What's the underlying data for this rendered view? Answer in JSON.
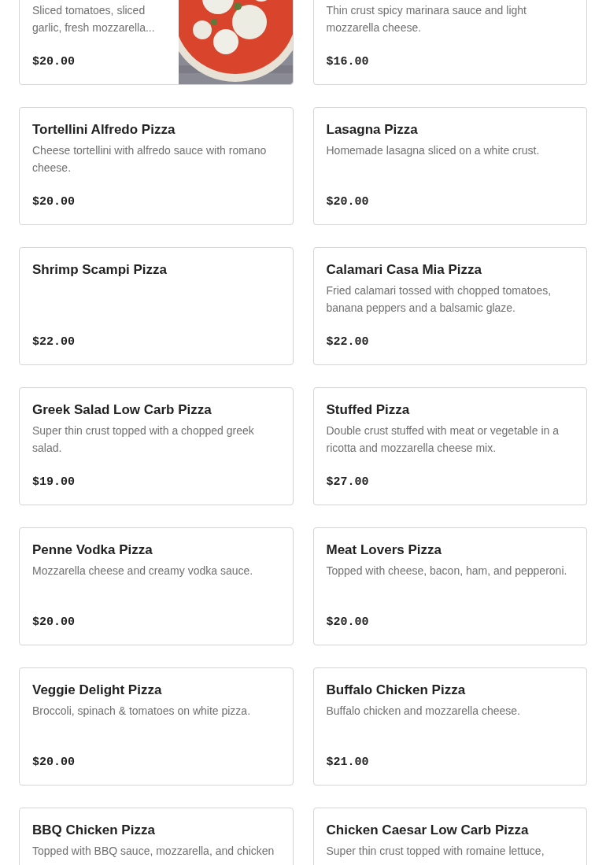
{
  "menu_items": [
    {
      "kind": "with-photo",
      "description": "Sliced tomatoes, sliced garlic, fresh mozzarella...",
      "price": "$20.00"
    },
    {
      "kind": "plain",
      "description": "Thin crust spicy marinara sauce and light mozzarella cheese.",
      "price": "$16.00"
    },
    {
      "kind": "plain",
      "name": "Tortellini Alfredo Pizza",
      "description": "Cheese tortellini with alfredo sauce with romano cheese.",
      "price": "$20.00"
    },
    {
      "kind": "plain",
      "name": "Lasagna Pizza",
      "description": "Homemade lasagna sliced on a white crust.",
      "price": "$20.00"
    },
    {
      "kind": "plain",
      "name": "Shrimp Scampi Pizza",
      "price": "$22.00"
    },
    {
      "kind": "plain",
      "name": "Calamari Casa Mia Pizza",
      "description": "Fried calamari tossed with chopped tomatoes, banana peppers and a balsamic glaze.",
      "price": "$22.00"
    },
    {
      "kind": "plain",
      "name": "Greek Salad Low Carb Pizza",
      "description": "Super thin crust topped with a chopped greek salad.",
      "price": "$19.00"
    },
    {
      "kind": "plain",
      "name": "Stuffed Pizza",
      "description": "Double crust stuffed with meat or vegetable in a ricotta and mozzarella cheese mix.",
      "price": "$27.00"
    },
    {
      "kind": "plain",
      "name": "Penne Vodka Pizza",
      "description": "Mozzarella cheese and creamy vodka sauce.",
      "price": "$20.00"
    },
    {
      "kind": "plain",
      "name": "Meat Lovers Pizza",
      "description": "Topped with cheese, bacon, ham, and pepperoni.",
      "price": "$20.00"
    },
    {
      "kind": "plain",
      "name": "Veggie Delight Pizza",
      "description": "Broccoli, spinach & tomatoes on white pizza.",
      "price": "$20.00"
    },
    {
      "kind": "plain",
      "name": "Buffalo Chicken Pizza",
      "description": "Buffalo chicken and mozzarella cheese.",
      "price": "$21.00"
    },
    {
      "kind": "plain",
      "name": "BBQ Chicken Pizza",
      "description": "Topped with BBQ sauce, mozzarella, and chicken"
    },
    {
      "kind": "plain",
      "name": "Chicken Caesar Low Carb Pizza",
      "description": "Super thin crust topped with romaine lettuce,"
    }
  ]
}
